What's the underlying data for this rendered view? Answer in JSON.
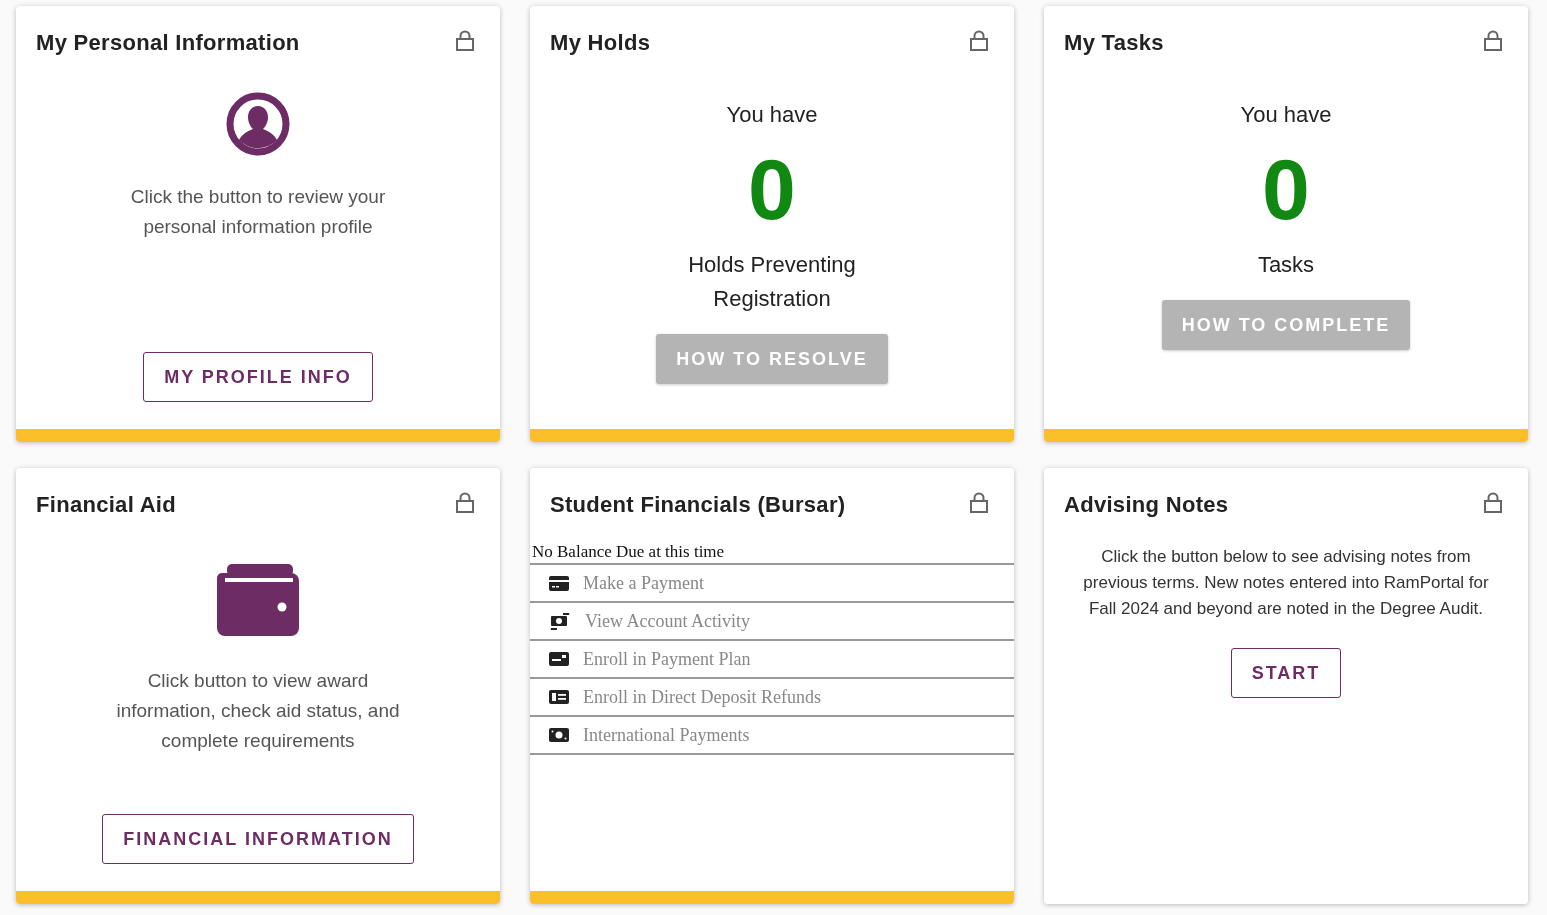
{
  "cards": [
    {
      "kind": "profile",
      "title": "My Personal Information",
      "locked": true,
      "accent": true,
      "text": "Click the button to review your personal information profile",
      "button": {
        "label": "MY PROFILE INFO",
        "disabled": false
      }
    },
    {
      "kind": "count",
      "title": "My Holds",
      "locked": true,
      "accent": true,
      "lead": "You have",
      "count": "0",
      "label": "Holds Preventing Registration",
      "button": {
        "label": "HOW TO RESOLVE",
        "disabled": true
      }
    },
    {
      "kind": "count",
      "title": "My Tasks",
      "locked": true,
      "accent": true,
      "lead": "You have",
      "count": "0",
      "label": "Tasks",
      "button": {
        "label": "HOW TO COMPLETE",
        "disabled": true
      }
    },
    {
      "kind": "aid",
      "title": "Financial Aid",
      "locked": true,
      "accent": true,
      "text": "Click button to view award information, check aid status, and complete requirements",
      "button": {
        "label": "FINANCIAL INFORMATION",
        "disabled": false
      }
    },
    {
      "kind": "links",
      "title": "Student Financials (Bursar)",
      "locked": true,
      "accent": true,
      "status": "No Balance Due at this time",
      "links": [
        {
          "kind": "card",
          "label": "Make a Payment"
        },
        {
          "kind": "exchange",
          "label": "View Account Activity"
        },
        {
          "kind": "plan",
          "label": "Enroll in Payment Plan"
        },
        {
          "kind": "deposit",
          "label": "Enroll in Direct Deposit Refunds"
        },
        {
          "kind": "bill",
          "label": "International Payments"
        }
      ]
    },
    {
      "kind": "notes",
      "title": "Advising Notes",
      "locked": true,
      "accent": false,
      "text": "Click the button below to see advising notes from previous terms. New notes entered into RamPortal for Fall 2024 and beyond are noted in the Degree Audit.",
      "button": {
        "label": "START",
        "disabled": false
      }
    }
  ]
}
